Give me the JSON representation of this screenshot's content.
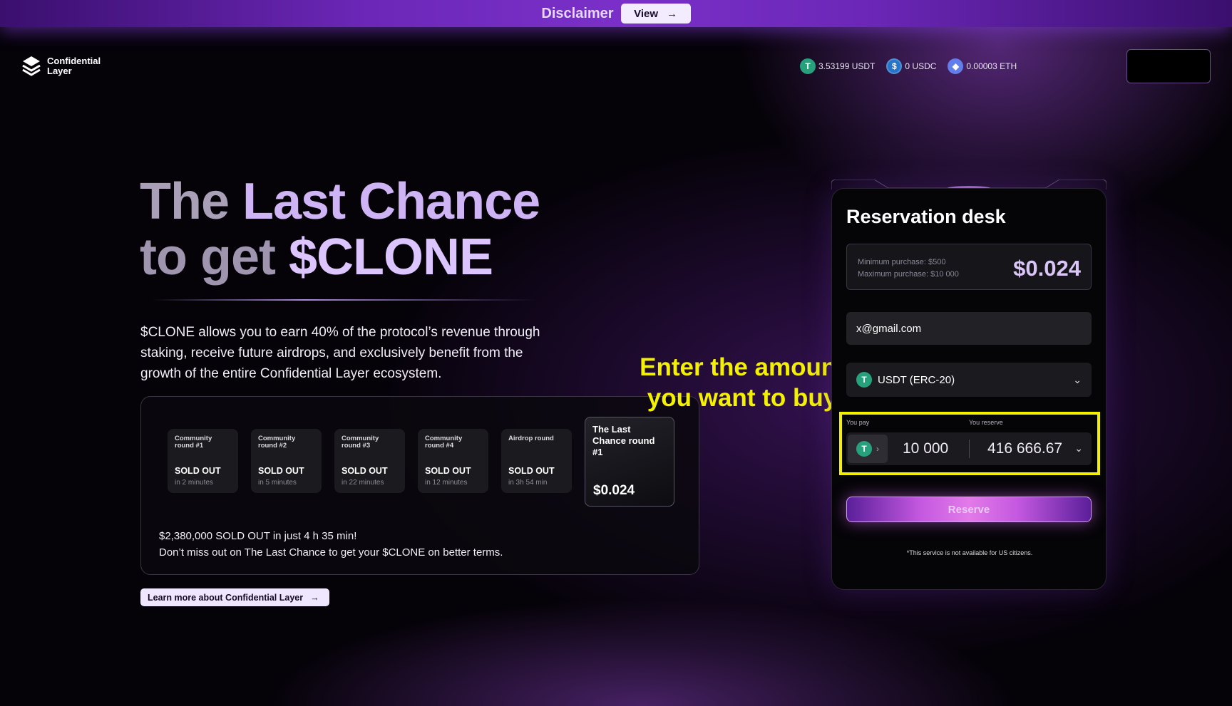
{
  "banner": {
    "title": "Disclaimer",
    "view_label": "View",
    "view_arrow": "→"
  },
  "logo": {
    "line1": "Confidential",
    "line2": "Layer",
    "icon": "layers-icon"
  },
  "balances": [
    {
      "icon": "usdt-icon",
      "symbol": "T",
      "text": "3.53199 USDT"
    },
    {
      "icon": "usdc-icon",
      "symbol": "$",
      "text": "0 USDC"
    },
    {
      "icon": "eth-icon",
      "symbol": "◆",
      "text": "0.00003 ETH"
    }
  ],
  "hero": {
    "line1_a": "The",
    "line1_b": "Last Chance",
    "line2_a": "to get",
    "line2_b": "$CLONE",
    "description": "$CLONE allows you to earn 40% of the protocol’s revenue through staking, receive future airdrops, and exclusively benefit from the growth of the entire Confidential Layer ecosystem."
  },
  "rounds": [
    {
      "name": "Community round #1",
      "status": "SOLD OUT",
      "time": "in 2 minutes"
    },
    {
      "name": "Community round #2",
      "status": "SOLD OUT",
      "time": "in 5 minutes"
    },
    {
      "name": "Community round #3",
      "status": "SOLD OUT",
      "time": "in 22 minutes"
    },
    {
      "name": "Community round #4",
      "status": "SOLD OUT",
      "time": "in 12 minutes"
    },
    {
      "name": "Airdrop round",
      "status": "SOLD OUT",
      "time": "in 3h 54 min"
    }
  ],
  "active_round": {
    "name": "The Last Chance round #1",
    "price": "$0.024"
  },
  "rounds_footer": {
    "line1": "$2,380,000 SOLD OUT in just 4 h 35 min!",
    "line2": "Don’t miss out on The Last Chance to get your $CLONE on better terms."
  },
  "learn_more": {
    "label": "Learn more about Confidential Layer",
    "arrow": "→"
  },
  "annotation": {
    "line1": "Enter the amount",
    "line2": "you want to buy"
  },
  "desk": {
    "title": "Reservation desk",
    "min_label": "Minimum purchase:",
    "min_value": "$500",
    "max_label": "Maximum purchase:",
    "max_value": "$10 000",
    "price": "$0.024",
    "email_value": "x@gmail.com",
    "currency": "USDT (ERC-20)",
    "you_pay_label": "You pay",
    "you_reserve_label": "You reserve",
    "pay_value": "10 000",
    "reserve_value": "416 666.67",
    "reserve_button": "Reserve",
    "note": "*This service is not available for US citizens."
  },
  "colors": {
    "accent": "#7a30c8",
    "highlight": "#f4f100",
    "usdt": "#26a17b",
    "usdc": "#2775ca",
    "eth": "#627eea"
  }
}
